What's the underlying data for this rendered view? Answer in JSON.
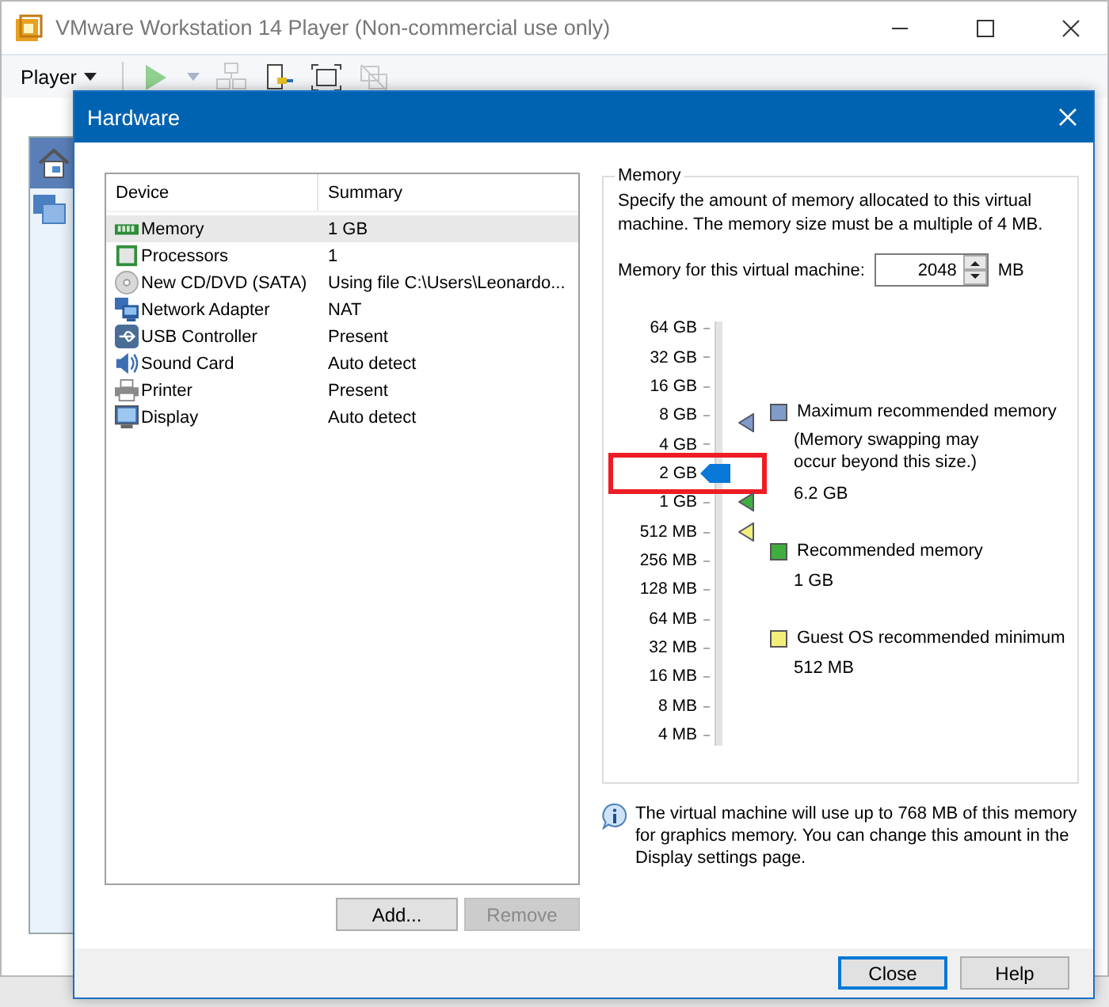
{
  "window": {
    "title": "VMware Workstation 14 Player (Non-commercial use only)"
  },
  "toolbar": {
    "menu": "Player"
  },
  "dialog": {
    "title": "Hardware",
    "device_table": {
      "columns": [
        "Device",
        "Summary"
      ],
      "rows": [
        {
          "kind": "memory",
          "device": "Memory",
          "summary": "1 GB",
          "selected": true
        },
        {
          "kind": "processor",
          "device": "Processors",
          "summary": "1",
          "selected": false
        },
        {
          "kind": "disc",
          "device": "New CD/DVD (SATA)",
          "summary": "Using file C:\\Users\\Leonardo...",
          "selected": false
        },
        {
          "kind": "network",
          "device": "Network Adapter",
          "summary": "NAT",
          "selected": false
        },
        {
          "kind": "usb",
          "device": "USB Controller",
          "summary": "Present",
          "selected": false
        },
        {
          "kind": "sound",
          "device": "Sound Card",
          "summary": "Auto detect",
          "selected": false
        },
        {
          "kind": "printer",
          "device": "Printer",
          "summary": "Present",
          "selected": false
        },
        {
          "kind": "display",
          "device": "Display",
          "summary": "Auto detect",
          "selected": false
        }
      ]
    },
    "buttons": [
      {
        "label": "Add...",
        "disabled": false
      },
      {
        "label": "Remove",
        "disabled": true
      }
    ],
    "memory": {
      "title": "Memory",
      "description": "Specify the amount of memory allocated to this virtual machine. The memory size must be a multiple of 4 MB.",
      "field_label": "Memory for this virtual machine:",
      "value": "2048",
      "unit": "MB",
      "scale": {
        "level": 0.643,
        "ticks": [
          {
            "label": "64 GB",
            "highlighted": false
          },
          {
            "label": "32 GB",
            "highlighted": false
          },
          {
            "label": "16 GB",
            "highlighted": false
          },
          {
            "label": "8 GB",
            "highlighted": false,
            "marker": {
              "color": "#7f9cc8"
            }
          },
          {
            "label": "4 GB",
            "highlighted": false
          },
          {
            "label": "2 GB",
            "highlighted": true
          },
          {
            "label": "1 GB",
            "highlighted": false,
            "marker": {
              "color": "#3fae3f"
            }
          },
          {
            "label": "512 MB",
            "highlighted": false,
            "marker": {
              "color": "#f2ee7a"
            }
          },
          {
            "label": "256 MB",
            "highlighted": false
          },
          {
            "label": "128 MB",
            "highlighted": false
          },
          {
            "label": "64 MB",
            "highlighted": false
          },
          {
            "label": "32 MB",
            "highlighted": false
          },
          {
            "label": "16 MB",
            "highlighted": false
          },
          {
            "label": "8 MB",
            "highlighted": false
          },
          {
            "label": "4 MB",
            "highlighted": false
          }
        ]
      },
      "markers": [
        {
          "color": "#7f9cc8",
          "label": "Maximum recommended memory",
          "note": "(Memory swapping may occur beyond this size.)",
          "value": "6.2 GB"
        },
        {
          "color": "#3fae3f",
          "label": "Recommended memory",
          "value": "1 GB"
        },
        {
          "color": "#f2ee7a",
          "label": "Guest OS recommended minimum",
          "value": "512 MB"
        }
      ]
    },
    "info": "The virtual machine will use up to 768 MB of this memory for graphics memory. You can change this amount in the Display settings page.",
    "footer_buttons": [
      {
        "label": "Close",
        "default": true
      },
      {
        "label": "Help",
        "default": false
      }
    ]
  }
}
